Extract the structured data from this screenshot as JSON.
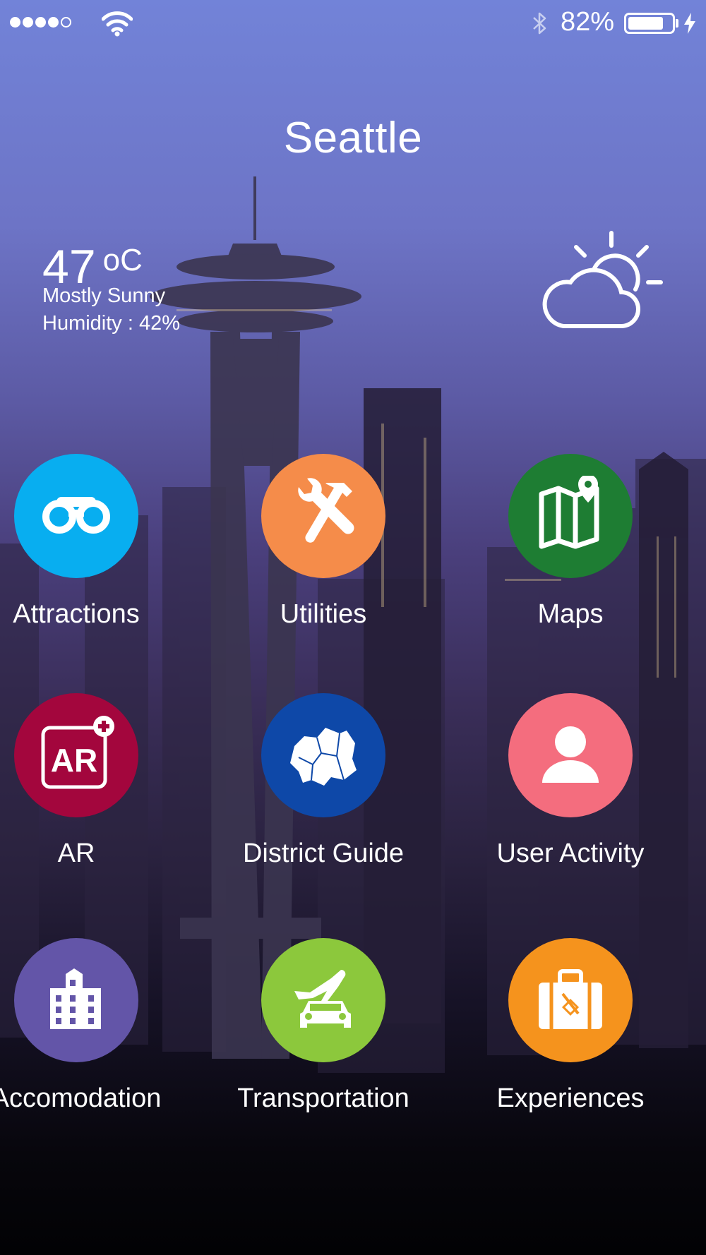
{
  "status_bar": {
    "battery_percent_label": "82%",
    "battery_level": 0.82,
    "signal_bars_filled": 4,
    "signal_bars_total": 5
  },
  "header": {
    "city": "Seattle"
  },
  "weather": {
    "temperature_value": "47",
    "temperature_unit": "oC",
    "condition": "Mostly Sunny",
    "humidity": "Humidity : 42%",
    "icon": "partly-sunny-icon"
  },
  "tiles": [
    {
      "label": "Attractions",
      "icon": "binoculars-icon",
      "color": "#08aef0"
    },
    {
      "label": "Utilities",
      "icon": "tools-icon",
      "color": "#f58c4a"
    },
    {
      "label": "Maps",
      "icon": "map-pin-icon",
      "color": "#1e7d33"
    },
    {
      "label": "AR",
      "icon": "ar-plus-icon",
      "color": "#a3063d"
    },
    {
      "label": "District Guide",
      "icon": "district-map-icon",
      "color": "#0e48a8"
    },
    {
      "label": "User Activity",
      "icon": "user-icon",
      "color": "#f46d7e"
    },
    {
      "label": "Accomodation",
      "icon": "building-icon",
      "color": "#6355a8"
    },
    {
      "label": "Transportation",
      "icon": "plane-car-icon",
      "color": "#8cc83c"
    },
    {
      "label": "Experiences",
      "icon": "luggage-icon",
      "color": "#f5931d"
    }
  ]
}
